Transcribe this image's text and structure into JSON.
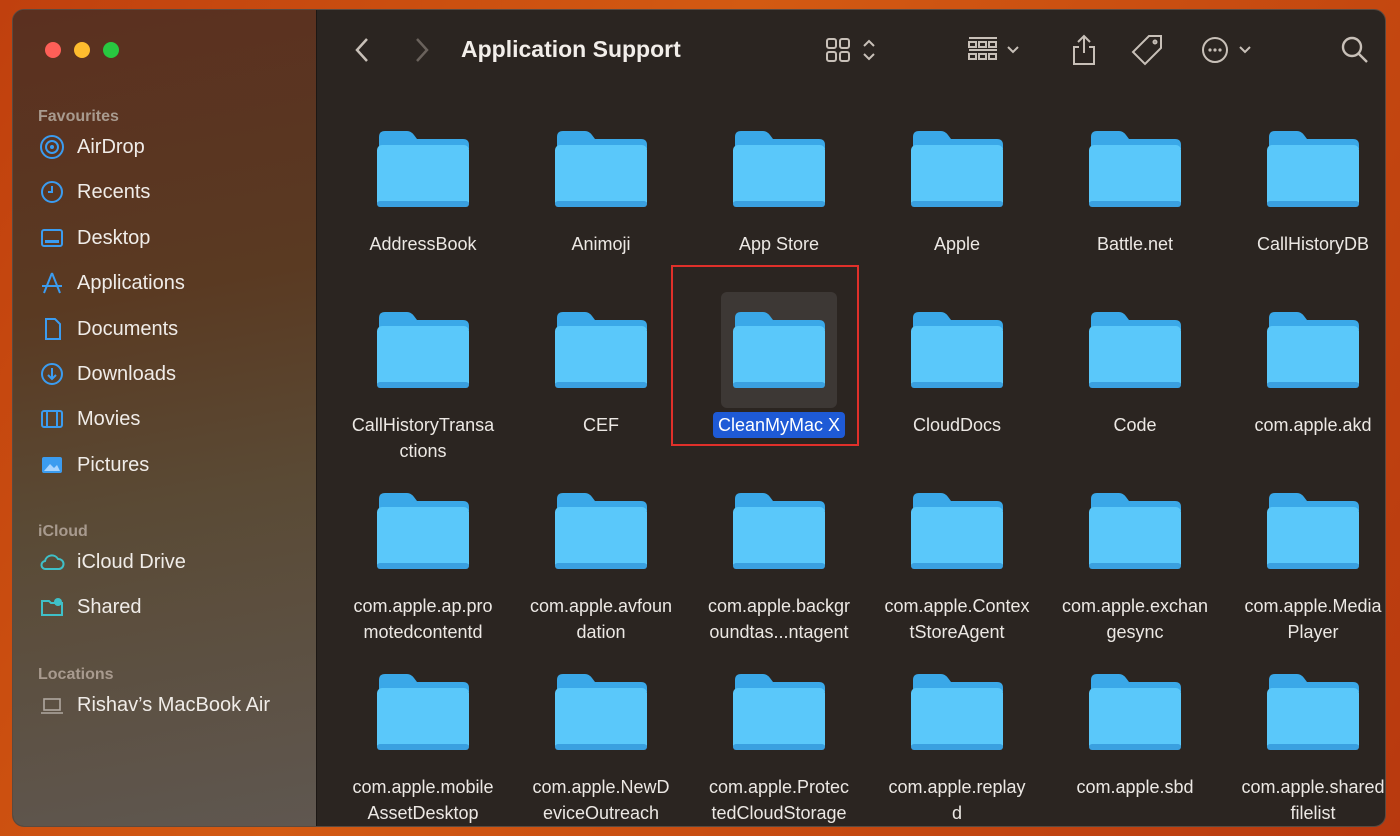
{
  "window": {
    "title": "Application Support"
  },
  "sidebar": {
    "sections": [
      {
        "header": "Favourites",
        "items": [
          {
            "label": "AirDrop",
            "icon": "airdrop-icon"
          },
          {
            "label": "Recents",
            "icon": "clock-icon"
          },
          {
            "label": "Desktop",
            "icon": "desktop-icon"
          },
          {
            "label": "Applications",
            "icon": "applications-icon"
          },
          {
            "label": "Documents",
            "icon": "document-icon"
          },
          {
            "label": "Downloads",
            "icon": "download-icon"
          },
          {
            "label": "Movies",
            "icon": "film-icon"
          },
          {
            "label": "Pictures",
            "icon": "photo-icon"
          }
        ]
      },
      {
        "header": "iCloud",
        "items": [
          {
            "label": "iCloud Drive",
            "icon": "cloud-icon"
          },
          {
            "label": "Shared",
            "icon": "shared-folder-icon"
          }
        ]
      },
      {
        "header": "Locations",
        "items": [
          {
            "label": "Rishav’s MacBook Air",
            "icon": "laptop-icon"
          }
        ]
      }
    ]
  },
  "toolbar": {
    "icons": [
      "back-icon",
      "forward-icon",
      "icon-view-icon",
      "group-icon",
      "share-icon",
      "tag-icon",
      "more-icon",
      "search-icon"
    ]
  },
  "folders": [
    "AddressBook",
    "Animoji",
    "App Store",
    "Apple",
    "Battle.net",
    "CallHistoryDB",
    "CallHistoryTransa\nctions",
    "CEF",
    "CleanMyMac X",
    "CloudDocs",
    "Code",
    "com.apple.akd",
    "com.apple.ap.pro\nmotedcontentd",
    "com.apple.avfoun\ndation",
    "com.apple.backgr\noundtas...ntagent",
    "com.apple.Contex\ntStoreAgent",
    "com.apple.exchan\ngesync",
    "com.apple.Media\nPlayer",
    "com.apple.mobile\nAssetDesktop",
    "com.apple.NewD\neviceOutreach",
    "com.apple.Protec\ntedCloudStorage",
    "com.apple.replay\nd",
    "com.apple.sbd",
    "com.apple.shared\nfilelist"
  ],
  "selected_folder": "CleanMyMac X",
  "colors": {
    "folder": "#5ac8fa",
    "accent": "#1e5ad6",
    "highlight_box": "#e0302a"
  }
}
